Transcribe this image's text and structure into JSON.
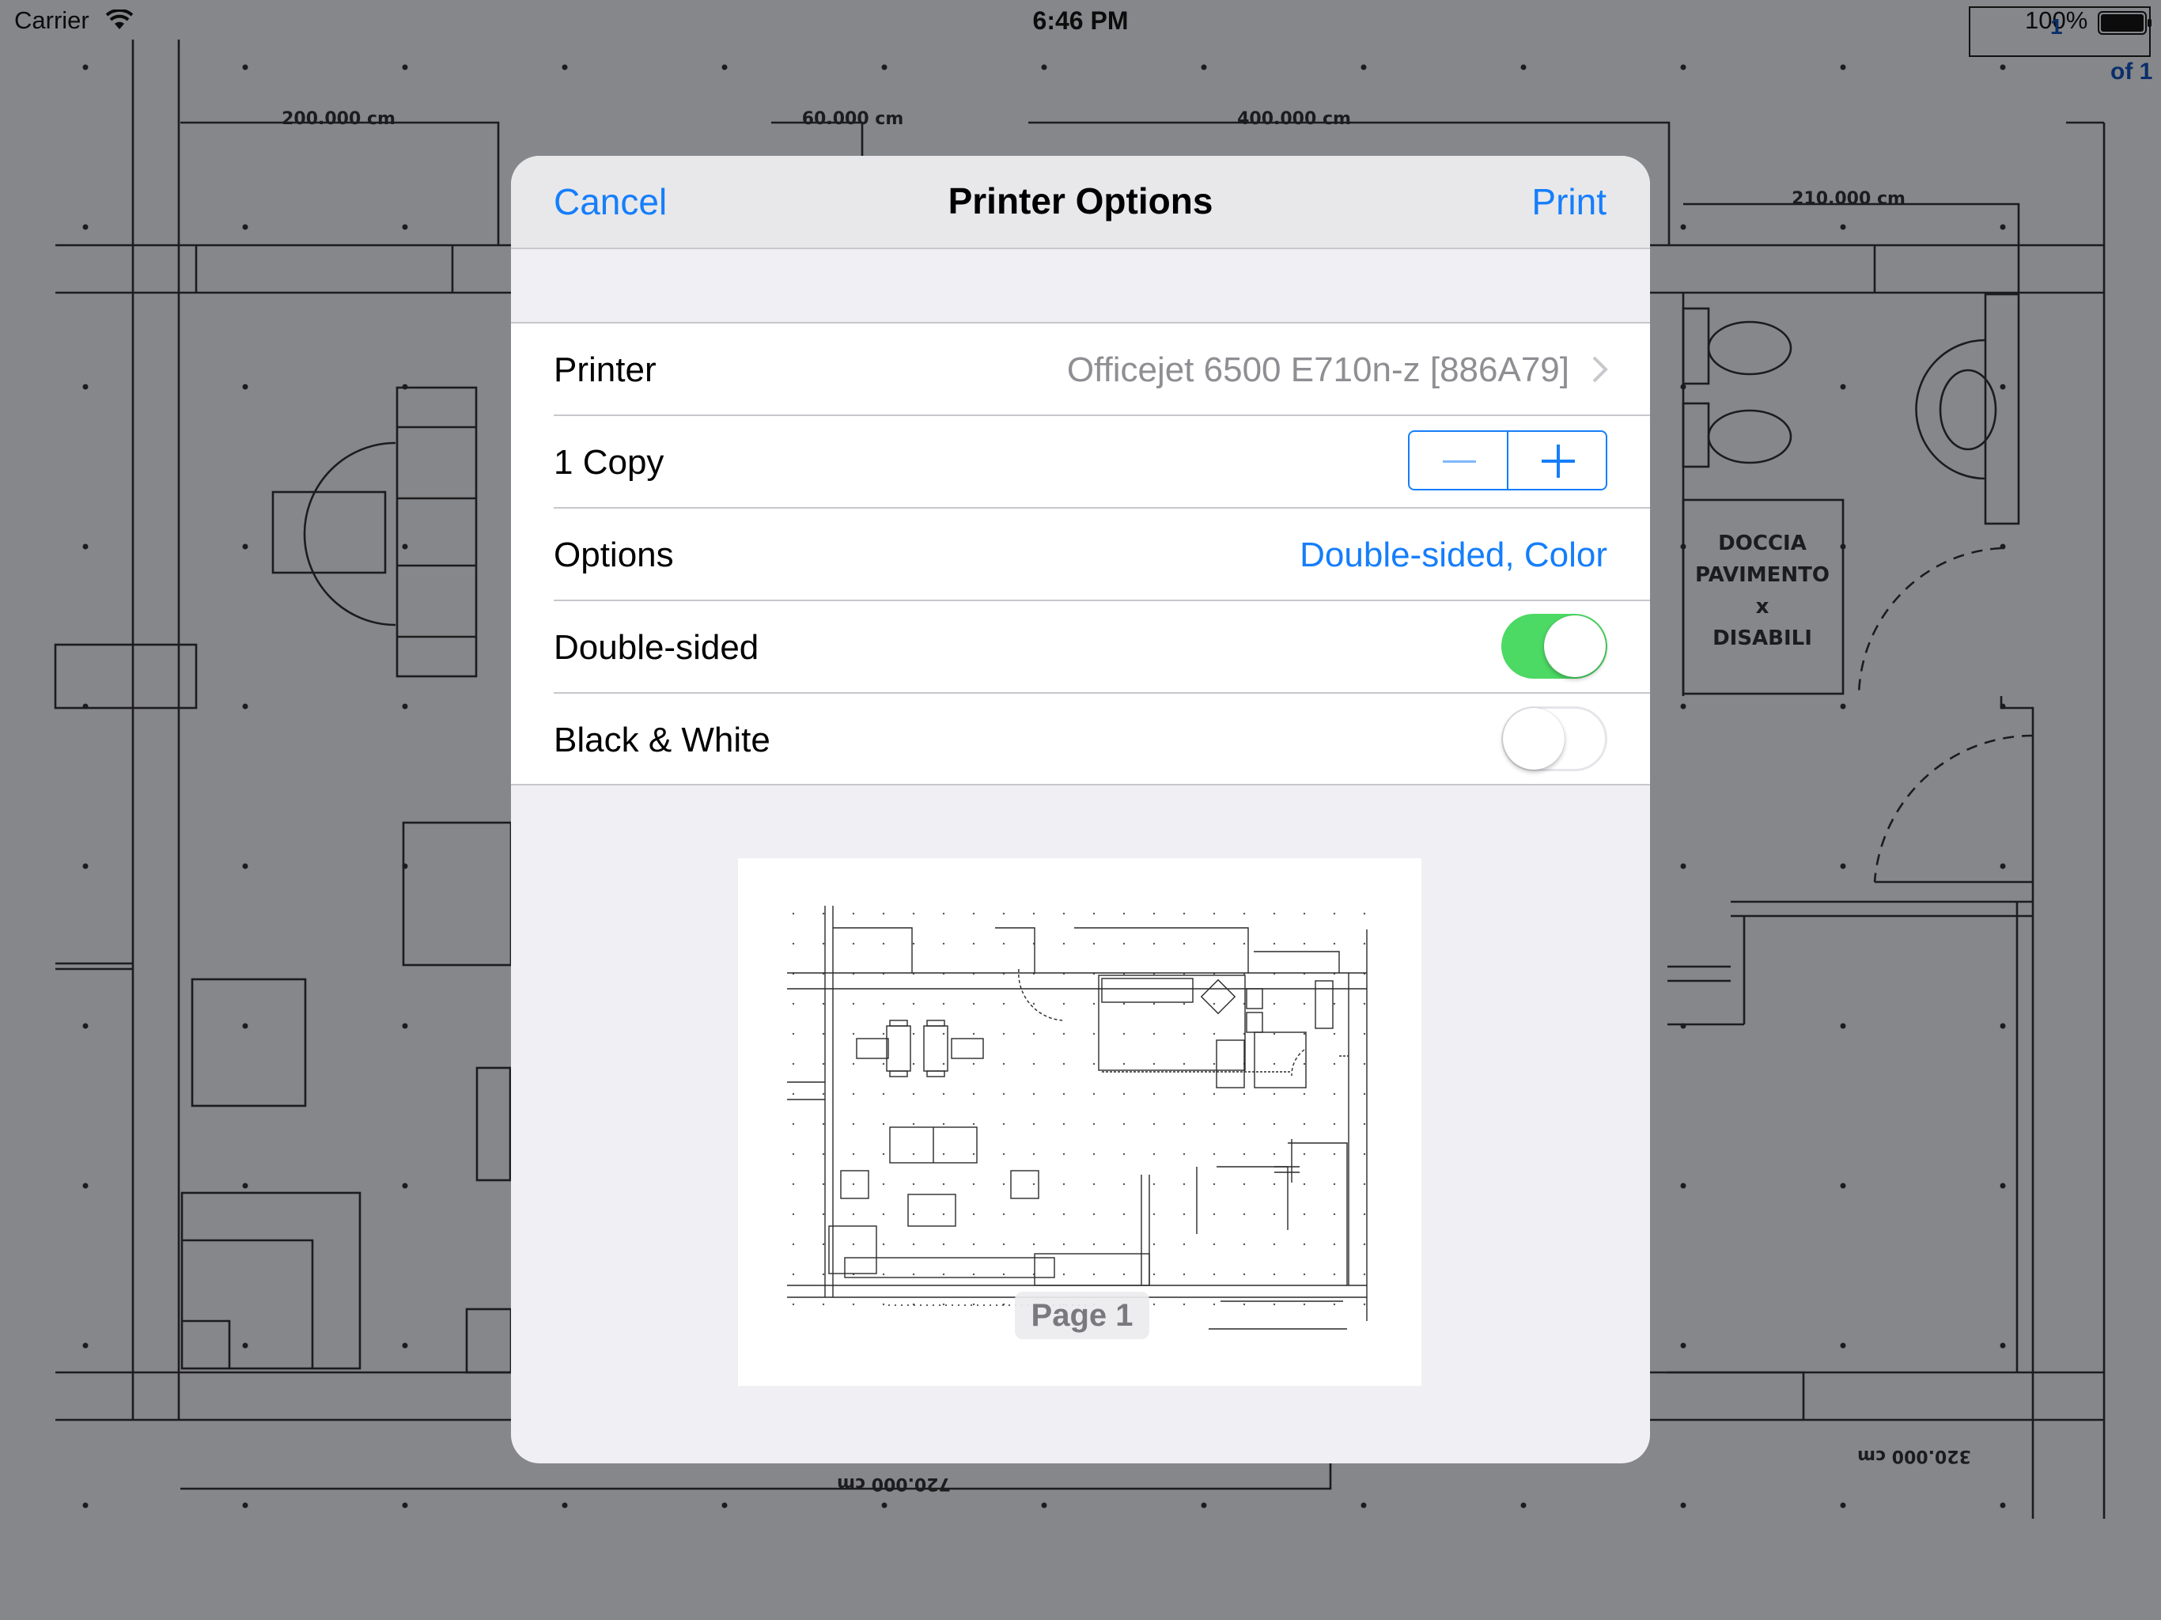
{
  "status_bar": {
    "carrier": "Carrier",
    "time": "6:46 PM",
    "battery_percent": "100%",
    "page_number": "1",
    "page_of": "of 1"
  },
  "background": {
    "dimension_labels": [
      "200.000 cm",
      "60.000 cm",
      "400.000 cm",
      "210.000 cm",
      "720.000 cm",
      "320.000 cm"
    ],
    "room_label_lines": [
      "DOCCIA",
      "PAVIMENTO",
      "x",
      "DISABILI"
    ]
  },
  "sheet": {
    "title": "Printer Options",
    "cancel_label": "Cancel",
    "print_label": "Print",
    "rows": {
      "printer": {
        "label": "Printer",
        "value": "Officejet 6500 E710n-z [886A79]"
      },
      "copies": {
        "label": "1 Copy",
        "count": 1
      },
      "options": {
        "label": "Options",
        "value": "Double-sided, Color"
      },
      "double_sided": {
        "label": "Double-sided",
        "on": true
      },
      "black_white": {
        "label": "Black & White",
        "on": false
      }
    },
    "preview": {
      "page_label": "Page 1"
    }
  },
  "colors": {
    "accent": "#157efb",
    "switch_on": "#4cd964",
    "dim_background": "#86878a"
  }
}
